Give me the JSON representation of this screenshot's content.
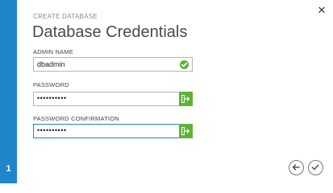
{
  "wizard": {
    "step_number": "1",
    "subtitle": "CREATE DATABASE",
    "title": "Database Credentials"
  },
  "form": {
    "admin_name": {
      "label": "ADMIN NAME",
      "value": "dbadmin"
    },
    "password": {
      "label": "PASSWORD",
      "value": "••••••••••"
    },
    "password_confirmation": {
      "label": "PASSWORD CONFIRMATION",
      "value": "••••••••••"
    }
  },
  "icons": {
    "close": "close-icon",
    "valid": "check-circle-icon",
    "password_strength": "key-icon",
    "back": "arrow-left-icon",
    "finish": "check-icon"
  },
  "colors": {
    "accent": "#1f86c9",
    "success": "#5fb336"
  }
}
